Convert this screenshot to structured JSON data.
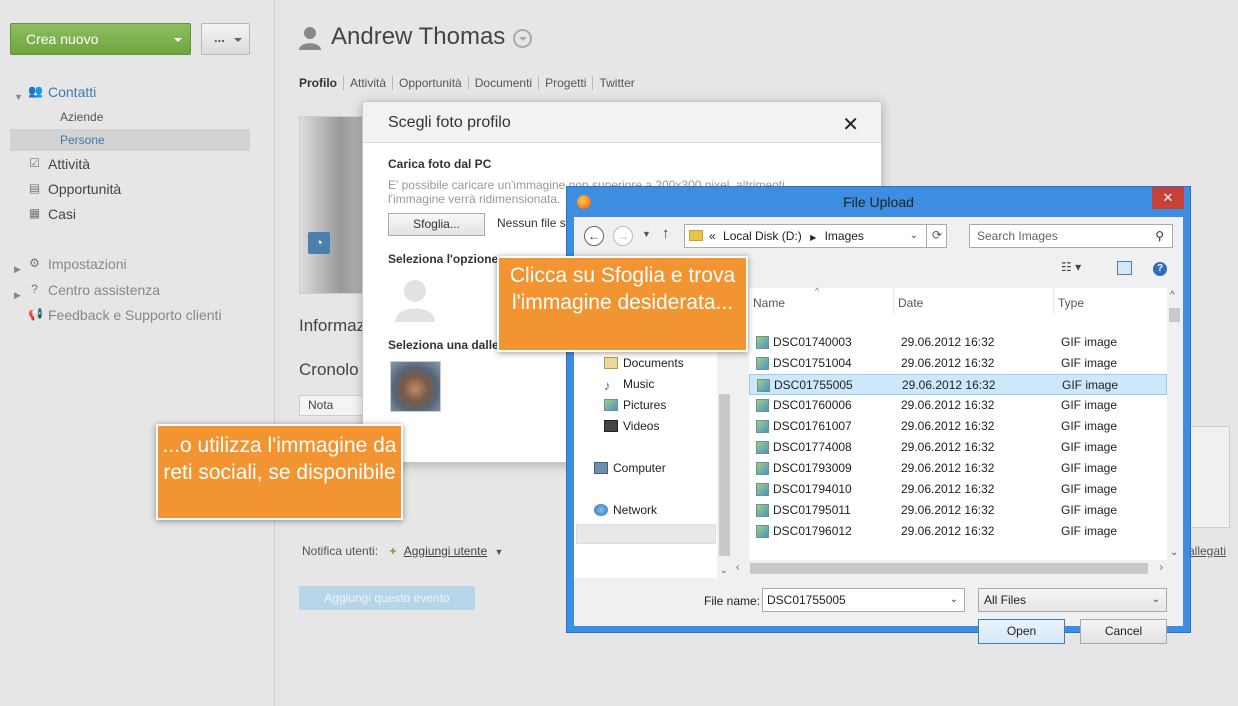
{
  "sidebar": {
    "create_label": "Crea nuovo",
    "more_label": "...",
    "items": [
      {
        "label": "Contatti"
      },
      {
        "label": "Aziende"
      },
      {
        "label": "Persone"
      },
      {
        "label": "Attività"
      },
      {
        "label": "Opportunità"
      },
      {
        "label": "Casi"
      },
      {
        "label": "Impostazioni"
      },
      {
        "label": "Centro assistenza"
      },
      {
        "label": "Feedback e Supporto clienti"
      }
    ]
  },
  "main": {
    "title": "Andrew Thomas",
    "tabs": [
      "Profilo",
      "Attività",
      "Opportunità",
      "Documenti",
      "Progetti",
      "Twitter"
    ],
    "section_info": "Informaz",
    "section_history": "Cronolo",
    "note_tab": "Nota",
    "notify_label": "Notifica utenti:",
    "add_user": "Aggiungi utente",
    "add_event": "Aggiungi questo evento",
    "attachments": "allegati"
  },
  "photo_dialog": {
    "title": "Scegli foto profilo",
    "upload_label": "Carica foto dal PC",
    "upload_desc": "E' possibile caricare un'immagine non superiore a 200x300 pixel, altrimenti l'immagine verrà ridimensionata.",
    "browse_button": "Sfoglia...",
    "no_file": "Nessun file s",
    "option_label": "Seleziona l'opzione",
    "social_label": "Seleziona una dalle"
  },
  "file_dialog": {
    "title": "File Upload",
    "address": {
      "chevron": "«",
      "drive": "Local Disk (D:)",
      "folder": "Images"
    },
    "search_placeholder": "Search Images",
    "nav_tree": [
      "Documents",
      "Music",
      "Pictures",
      "Videos",
      "Computer",
      "Network"
    ],
    "columns": {
      "name": "Name",
      "date": "Date",
      "type": "Type"
    },
    "files": [
      {
        "name": "DSC01740003",
        "date": "29.06.2012 16:32",
        "type": "GIF image"
      },
      {
        "name": "DSC01751004",
        "date": "29.06.2012 16:32",
        "type": "GIF image"
      },
      {
        "name": "DSC01755005",
        "date": "29.06.2012 16:32",
        "type": "GIF image"
      },
      {
        "name": "DSC01760006",
        "date": "29.06.2012 16:32",
        "type": "GIF image"
      },
      {
        "name": "DSC01761007",
        "date": "29.06.2012 16:32",
        "type": "GIF image"
      },
      {
        "name": "DSC01774008",
        "date": "29.06.2012 16:32",
        "type": "GIF image"
      },
      {
        "name": "DSC01793009",
        "date": "29.06.2012 16:32",
        "type": "GIF image"
      },
      {
        "name": "DSC01794010",
        "date": "29.06.2012 16:32",
        "type": "GIF image"
      },
      {
        "name": "DSC01795011",
        "date": "29.06.2012 16:32",
        "type": "GIF image"
      },
      {
        "name": "DSC01796012",
        "date": "29.06.2012 16:32",
        "type": "GIF image"
      }
    ],
    "selected_file": "DSC01755005",
    "filename_label": "File name:",
    "filename_value": "DSC01755005",
    "filetype_value": "All Files",
    "open_button": "Open",
    "cancel_button": "Cancel"
  },
  "callouts": {
    "browse_hint": "Clicca su Sfoglia e trova l'immagine desiderata...",
    "social_hint": "...o utilizza l'immagine da reti sociali, se disponibile"
  },
  "colors": {
    "create_button": "#6fa540",
    "callout": "#f29431",
    "window_border": "#3d8ee0",
    "selected_row": "#cde8fb",
    "link": "#3b7cb0"
  }
}
